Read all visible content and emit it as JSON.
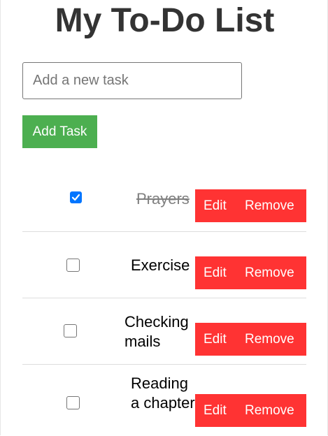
{
  "header": {
    "title": "My To-Do List"
  },
  "new_task": {
    "placeholder": "Add a new task",
    "value": "",
    "add_label": "Add Task"
  },
  "tasks": [
    {
      "label": "Prayers",
      "completed": true,
      "edit_label": "Edit",
      "remove_label": "Remove"
    },
    {
      "label": "Exercise",
      "completed": false,
      "edit_label": "Edit",
      "remove_label": "Remove"
    },
    {
      "label": "Checking mails",
      "completed": false,
      "edit_label": "Edit",
      "remove_label": "Remove"
    },
    {
      "label": "Reading a chapter",
      "completed": false,
      "edit_label": "Edit",
      "remove_label": "Remove"
    }
  ],
  "colors": {
    "add_button": "#4caf50",
    "action_buttons": "#ff3333",
    "checkbox_checked": "#0075ff",
    "title": "#333333"
  }
}
